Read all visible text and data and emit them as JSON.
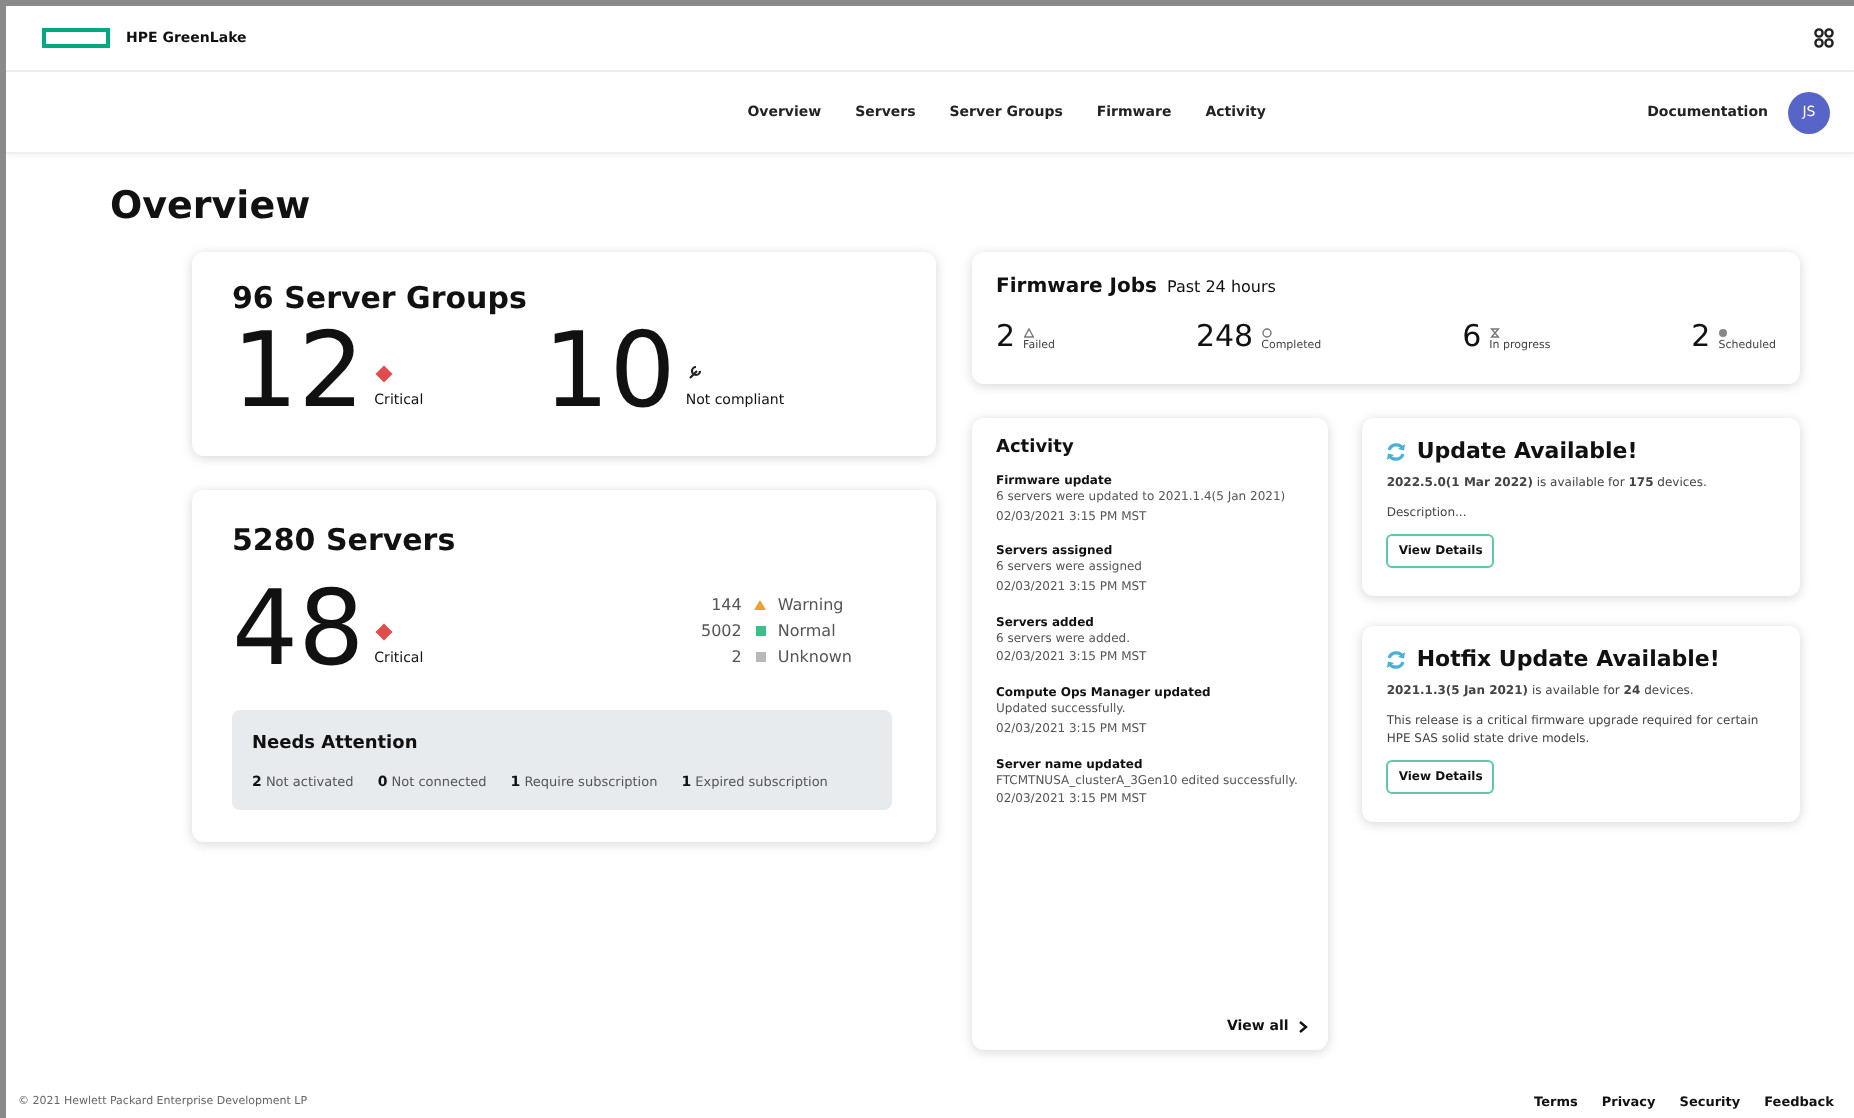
{
  "header": {
    "brand": "HPE GreenLake"
  },
  "nav": {
    "items": [
      "Overview",
      "Servers",
      "Server Groups",
      "Firmware",
      "Activity"
    ],
    "documentation": "Documentation",
    "avatar": "JS"
  },
  "page_title": "Overview",
  "server_groups": {
    "title": "96 Server Groups",
    "stats": [
      {
        "kind": "critical",
        "value": "12",
        "label": "Critical"
      },
      {
        "kind": "noncompliant",
        "value": "10",
        "label": "Not compliant"
      }
    ]
  },
  "servers": {
    "title": "5280 Servers",
    "critical": {
      "value": "48",
      "label": "Critical"
    },
    "statuses": [
      {
        "count": "144",
        "label": "Warning",
        "kind": "triangle",
        "color": "#f0a030"
      },
      {
        "count": "5002",
        "label": "Normal",
        "kind": "square",
        "color": "#3cc08a"
      },
      {
        "count": "2",
        "label": "Unknown",
        "kind": "square",
        "color": "#b8b8b8"
      }
    ],
    "needs_attention": {
      "title": "Needs Attention",
      "items": [
        {
          "count": "2",
          "label": "Not activated"
        },
        {
          "count": "0",
          "label": "Not connected"
        },
        {
          "count": "1",
          "label": "Require subscription"
        },
        {
          "count": "1",
          "label": "Expired subscription"
        }
      ]
    }
  },
  "firmware_jobs": {
    "title": "Firmware Jobs",
    "subtitle": "Past 24 hours",
    "jobs": [
      {
        "kind": "failed",
        "count": "2",
        "label": "Failed"
      },
      {
        "kind": "completed",
        "count": "248",
        "label": "Completed"
      },
      {
        "kind": "progress",
        "count": "6",
        "label": "In progress"
      },
      {
        "kind": "scheduled",
        "count": "2",
        "label": "Scheduled"
      }
    ]
  },
  "activity": {
    "title": "Activity",
    "entries": [
      {
        "title": "Firmware update",
        "text": "6 servers were updated to 2021.1.4(5 Jan 2021)",
        "time": "02/03/2021 3:15 PM MST"
      },
      {
        "title": "Servers assigned",
        "text": "6 servers were assigned",
        "time": "02/03/2021 3:15 PM MST"
      },
      {
        "title": "Servers added",
        "text": "6 servers were added.",
        "time": "02/03/2021 3:15 PM MST"
      },
      {
        "title": "Compute Ops Manager updated",
        "text": "Updated successfully.",
        "time": "02/03/2021 3:15 PM MST"
      },
      {
        "title": "Server name updated",
        "text": "FTCMTNUSA_clusterA_3Gen10 edited successfully.",
        "time": "02/03/2021 3:15 PM MST"
      }
    ],
    "view_all": "View all"
  },
  "updates": [
    {
      "title": "Update Available!",
      "summary": "**2022.5.0(1 Mar 2022)** is available for **175** devices.",
      "description": "Description...",
      "button": "View Details"
    },
    {
      "title": "Hotfix Update Available!",
      "summary": "**2021.1.3(5 Jan 2021)** is available for **24** devices.",
      "description": "This release is a critical firmware upgrade required for certain HPE SAS solid state drive models.",
      "button": "View Details"
    }
  ],
  "footer": {
    "copyright": "© 2021 Hewlett Packard Enterprise Development LP",
    "links": [
      "Terms",
      "Privacy",
      "Security",
      "Feedback"
    ]
  }
}
